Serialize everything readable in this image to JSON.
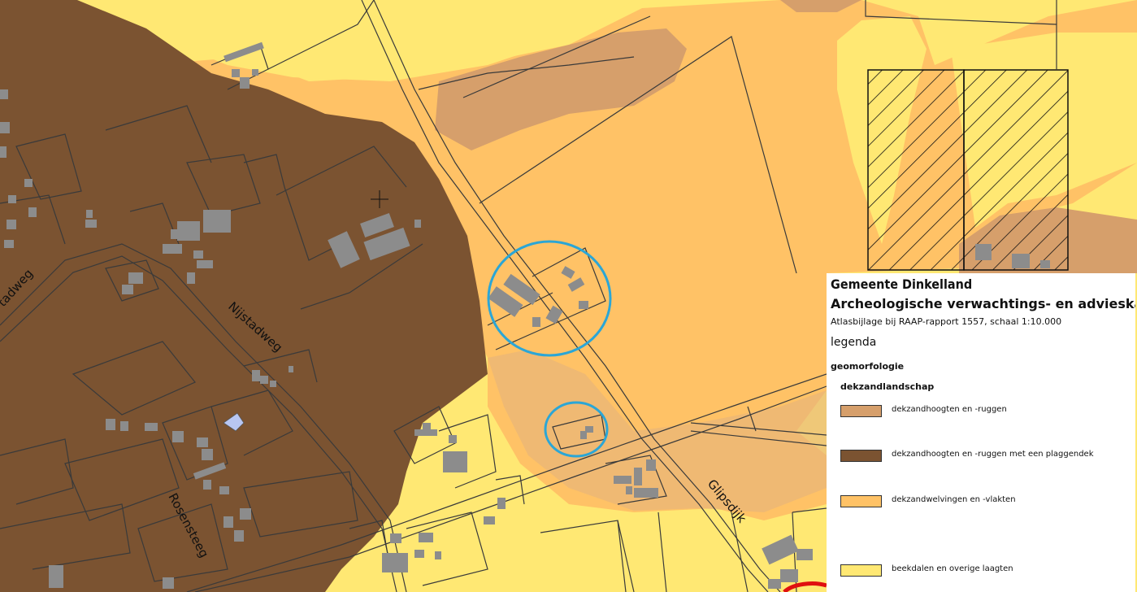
{
  "colors": {
    "beekdalen": "#ffe873",
    "welvingen": "#ffc266",
    "hoogten": "#d69f6b",
    "plaggendek": "#7b5331",
    "building": "#8c8c8c",
    "circle": "#2ba6d6",
    "line": "#3a3a3a"
  },
  "streets": {
    "nijstadweg": "Nijstadweg",
    "nijstadweg_left": "tadweg",
    "rosensteeg": "Rosensteeg",
    "glipsdijk": "Glipsdijk"
  },
  "legend": {
    "title1": "Gemeente Dinkelland",
    "title2": "Archeologische verwachtings- en advieskaart",
    "subtitle": "Atlasbijlage bij RAAP-rapport 1557, schaal 1:10.000",
    "legenda": "legenda",
    "heading1": "geomorfologie",
    "heading2": "dekzandlandschap",
    "items": [
      {
        "label": "dekzandhoogten en -ruggen",
        "color": "#d69f6b"
      },
      {
        "label": "dekzandhoogten en -ruggen met een plaggendek",
        "color": "#7b5331"
      },
      {
        "label": "dekzandwelvingen en -vlakten",
        "color": "#ffc266"
      },
      {
        "label": "beekdalen en overige laagten",
        "color": "#ffe873"
      }
    ]
  }
}
